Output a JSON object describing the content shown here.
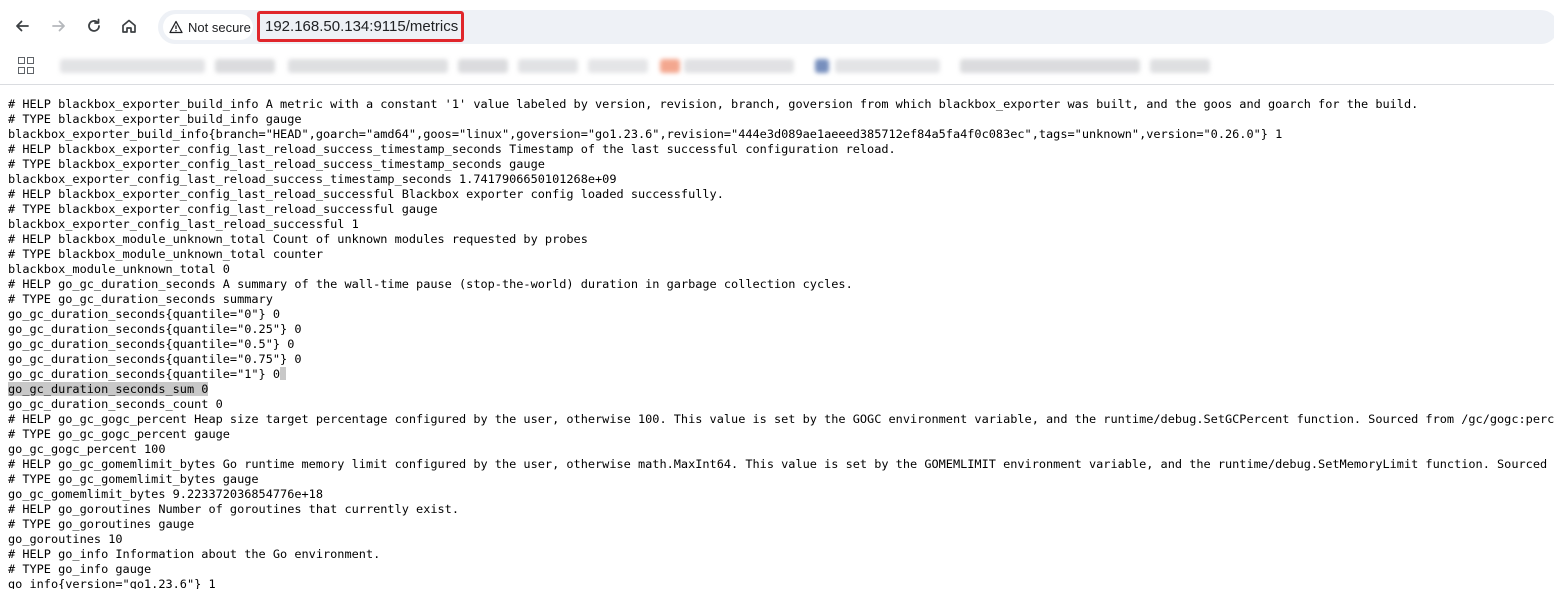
{
  "browser": {
    "security_label": "Not secure",
    "url_host": "192.168.50.134",
    "url_rest": ":9115/metrics",
    "accent_color": "#e0262b"
  },
  "icons": {
    "back": "back-arrow-icon",
    "forward": "forward-arrow-icon",
    "reload": "reload-icon",
    "home": "home-icon",
    "warning": "warning-triangle-icon",
    "apps": "apps-grid-icon"
  },
  "metrics": [
    "# HELP blackbox_exporter_build_info A metric with a constant '1' value labeled by version, revision, branch, goversion from which blackbox_exporter was built, and the goos and goarch for the build.",
    "# TYPE blackbox_exporter_build_info gauge",
    "blackbox_exporter_build_info{branch=\"HEAD\",goarch=\"amd64\",goos=\"linux\",goversion=\"go1.23.6\",revision=\"444e3d089ae1aeeed385712ef84a5fa4f0c083ec\",tags=\"unknown\",version=\"0.26.0\"} 1",
    "# HELP blackbox_exporter_config_last_reload_success_timestamp_seconds Timestamp of the last successful configuration reload.",
    "# TYPE blackbox_exporter_config_last_reload_success_timestamp_seconds gauge",
    "blackbox_exporter_config_last_reload_success_timestamp_seconds 1.7417906650101268e+09",
    "# HELP blackbox_exporter_config_last_reload_successful Blackbox exporter config loaded successfully.",
    "# TYPE blackbox_exporter_config_last_reload_successful gauge",
    "blackbox_exporter_config_last_reload_successful 1",
    "# HELP blackbox_module_unknown_total Count of unknown modules requested by probes",
    "# TYPE blackbox_module_unknown_total counter",
    "blackbox_module_unknown_total 0",
    "# HELP go_gc_duration_seconds A summary of the wall-time pause (stop-the-world) duration in garbage collection cycles.",
    "# TYPE go_gc_duration_seconds summary",
    "go_gc_duration_seconds{quantile=\"0\"} 0",
    "go_gc_duration_seconds{quantile=\"0.25\"} 0",
    "go_gc_duration_seconds{quantile=\"0.5\"} 0",
    "go_gc_duration_seconds{quantile=\"0.75\"} 0",
    "go_gc_duration_seconds{quantile=\"1\"} 0",
    "go_gc_duration_seconds_sum 0",
    "go_gc_duration_seconds_count 0",
    "# HELP go_gc_gogc_percent Heap size target percentage configured by the user, otherwise 100. This value is set by the GOGC environment variable, and the runtime/debug.SetGCPercent function. Sourced from /gc/gogc:perce",
    "# TYPE go_gc_gogc_percent gauge",
    "go_gc_gogc_percent 100",
    "# HELP go_gc_gomemlimit_bytes Go runtime memory limit configured by the user, otherwise math.MaxInt64. This value is set by the GOMEMLIMIT environment variable, and the runtime/debug.SetMemoryLimit function. Sourced f",
    "# TYPE go_gc_gomemlimit_bytes gauge",
    "go_gc_gomemlimit_bytes 9.223372036854776e+18",
    "# HELP go_goroutines Number of goroutines that currently exist.",
    "# TYPE go_goroutines gauge",
    "go_goroutines 10",
    "# HELP go_info Information about the Go environment.",
    "# TYPE go_info gauge",
    "go_info{version=\"go1.23.6\"} 1"
  ]
}
